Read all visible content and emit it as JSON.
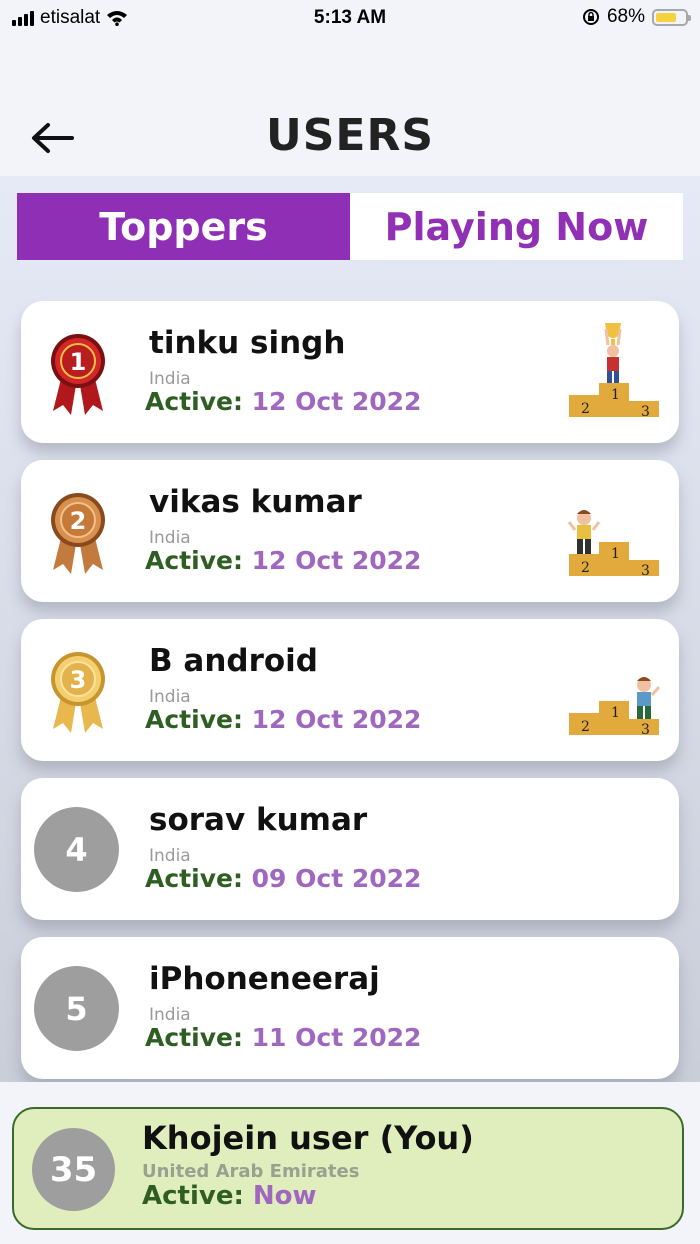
{
  "status_bar": {
    "carrier": "etisalat",
    "time": "5:13 AM",
    "battery": "68%"
  },
  "header": {
    "title": "USERS"
  },
  "tabs": [
    {
      "label": "Toppers",
      "active": true
    },
    {
      "label": "Playing Now",
      "active": false
    }
  ],
  "users": [
    {
      "rank": "1",
      "name": "tinku singh",
      "country": "India",
      "active_label": "Active:",
      "active_value": "12 Oct 2022",
      "medal": "gold-ribbon-medal"
    },
    {
      "rank": "2",
      "name": "vikas kumar",
      "country": "India",
      "active_label": "Active:",
      "active_value": "12 Oct 2022",
      "medal": "bronze-ribbon-medal"
    },
    {
      "rank": "3",
      "name": "B android",
      "country": "India",
      "active_label": "Active:",
      "active_value": "12 Oct 2022",
      "medal": "gold-ribbon-medal-light"
    },
    {
      "rank": "4",
      "name": "sorav kumar",
      "country": "India",
      "active_label": "Active:",
      "active_value": "09 Oct 2022"
    },
    {
      "rank": "5",
      "name": "iPhoneneeraj",
      "country": "India",
      "active_label": "Active:",
      "active_value": "11 Oct 2022"
    }
  ],
  "current_user": {
    "rank": "35",
    "name": "Khojein user (You)",
    "country": "United Arab Emirates",
    "active_label": "Active:",
    "active_value": "Now"
  },
  "podium_labels": [
    "1",
    "2",
    "3"
  ],
  "colors": {
    "accent": "#8f2fb5",
    "active_label": "#2e5e22",
    "active_value": "#a067be",
    "self_bg": "#e0eebe",
    "rank_circle": "#9e9e9e"
  }
}
